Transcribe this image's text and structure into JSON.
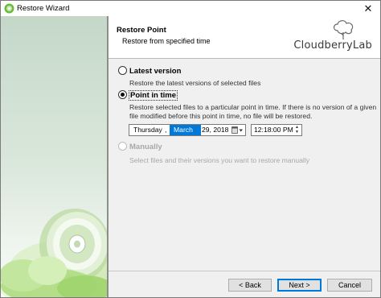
{
  "window": {
    "title": "Restore Wizard"
  },
  "header": {
    "title": "Restore Point",
    "subtitle": "Restore from specified time",
    "brand": "CloudberryLab"
  },
  "options": {
    "latest": {
      "label": "Latest version",
      "description": "Restore the latest versions of selected files",
      "selected": false,
      "enabled": true
    },
    "point_in_time": {
      "label": "Point in time",
      "description_line1": "Restore selected files to a particular point in time. If there is no version of a given",
      "description_line2": "file modified before this point in time, no file will be restored.",
      "selected": true,
      "enabled": true,
      "date": {
        "weekday": "Thursday",
        "sep": ",",
        "month": "March",
        "day_year": "29, 2018"
      },
      "time": "12:18:00 PM"
    },
    "manually": {
      "label": "Manually",
      "description": "Select files and their versions you want to restore manually",
      "selected": false,
      "enabled": false
    }
  },
  "buttons": {
    "back": "< Back",
    "next": "Next >",
    "cancel": "Cancel"
  },
  "colors": {
    "selection_blue": "#0078d7",
    "disabled_text": "#a8a8a8",
    "panel_green": "#cfe0d2"
  },
  "icons": {
    "app": "cloudberry-disc-icon",
    "close": "close-icon",
    "brand": "cloud-tree-icon",
    "calendar": "calendar-dropdown-icon",
    "spin": "spin-arrows-icon"
  }
}
